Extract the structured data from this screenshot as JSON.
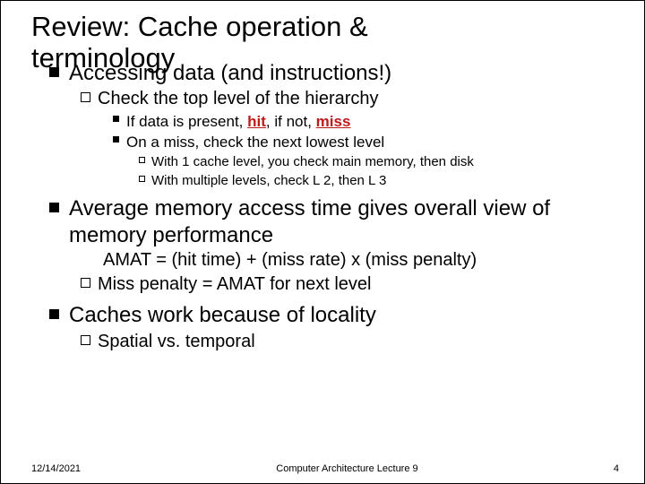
{
  "title_line1": "Review: Cache operation &",
  "title_line2": "terminology",
  "p1": "Accessing data (and instructions!)",
  "p1_1": "Check the top level of the hierarchy",
  "p1_1_1_prefix": "If data is present, ",
  "p1_1_1_hit": "hit",
  "p1_1_1_mid": ", if not, ",
  "p1_1_1_miss": "miss",
  "p1_1_2": "On a miss, check the next lowest level",
  "p1_1_2_1": "With 1 cache level, you check main memory, then disk",
  "p1_1_2_2": "With multiple levels, check L 2, then L 3",
  "p2": "Average memory access time gives overall view of memory performance",
  "formula": "AMAT = (hit time) + (miss rate) x (miss penalty)",
  "p2_1": "Miss penalty = AMAT for next level",
  "p3": "Caches work because of locality",
  "p3_1": "Spatial vs. temporal",
  "footer_date": "12/14/2021",
  "footer_center": "Computer Architecture Lecture 9",
  "footer_page": "4"
}
